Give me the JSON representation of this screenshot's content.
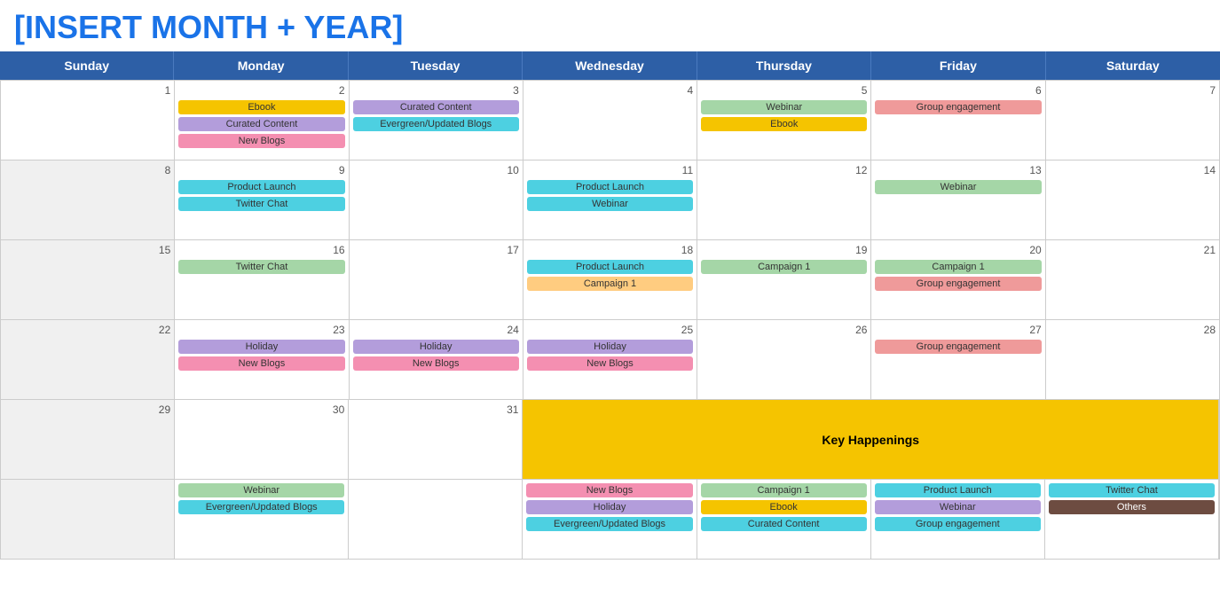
{
  "title": "[INSERT MONTH + YEAR]",
  "days": [
    "Sunday",
    "Monday",
    "Tuesday",
    "Wednesday",
    "Thursday",
    "Friday",
    "Saturday"
  ],
  "weeks": [
    {
      "cells": [
        {
          "date": "1",
          "gray": false,
          "events": []
        },
        {
          "date": "2",
          "gray": false,
          "events": [
            {
              "label": "Ebook",
              "color": "ev-yellow"
            },
            {
              "label": "Curated Content",
              "color": "ev-purple-light"
            },
            {
              "label": "New Blogs",
              "color": "ev-pink"
            }
          ]
        },
        {
          "date": "3",
          "gray": false,
          "events": [
            {
              "label": "Curated Content",
              "color": "ev-purple-light"
            },
            {
              "label": "Evergreen/Updated Blogs",
              "color": "ev-teal"
            }
          ]
        },
        {
          "date": "4",
          "gray": false,
          "events": []
        },
        {
          "date": "5",
          "gray": false,
          "events": [
            {
              "label": "Webinar",
              "color": "ev-green"
            },
            {
              "label": "Ebook",
              "color": "ev-yellow"
            }
          ]
        },
        {
          "date": "6",
          "gray": false,
          "events": [
            {
              "label": "Group engagement",
              "color": "ev-red-light"
            }
          ]
        },
        {
          "date": "7",
          "gray": false,
          "events": []
        }
      ]
    },
    {
      "cells": [
        {
          "date": "8",
          "gray": true,
          "events": []
        },
        {
          "date": "9",
          "gray": false,
          "events": [
            {
              "label": "Product Launch",
              "color": "ev-teal"
            },
            {
              "label": "Twitter Chat",
              "color": "ev-teal"
            }
          ]
        },
        {
          "date": "10",
          "gray": false,
          "events": []
        },
        {
          "date": "11",
          "gray": false,
          "events": [
            {
              "label": "Product Launch",
              "color": "ev-teal"
            },
            {
              "label": "Webinar",
              "color": "ev-teal"
            }
          ]
        },
        {
          "date": "12",
          "gray": false,
          "events": []
        },
        {
          "date": "13",
          "gray": false,
          "events": [
            {
              "label": "Webinar",
              "color": "ev-green"
            }
          ]
        },
        {
          "date": "14",
          "gray": false,
          "events": []
        }
      ]
    },
    {
      "cells": [
        {
          "date": "15",
          "gray": true,
          "events": []
        },
        {
          "date": "16",
          "gray": false,
          "events": [
            {
              "label": "Twitter Chat",
              "color": "ev-green"
            }
          ]
        },
        {
          "date": "17",
          "gray": false,
          "events": []
        },
        {
          "date": "18",
          "gray": false,
          "events": [
            {
              "label": "Product Launch",
              "color": "ev-teal"
            },
            {
              "label": "Campaign 1",
              "color": "ev-orange-light"
            }
          ]
        },
        {
          "date": "19",
          "gray": false,
          "events": [
            {
              "label": "Campaign 1",
              "color": "ev-green"
            }
          ]
        },
        {
          "date": "20",
          "gray": false,
          "events": [
            {
              "label": "Campaign 1",
              "color": "ev-green"
            },
            {
              "label": "Group engagement",
              "color": "ev-red-light"
            }
          ]
        },
        {
          "date": "21",
          "gray": false,
          "events": []
        }
      ]
    },
    {
      "cells": [
        {
          "date": "22",
          "gray": true,
          "events": []
        },
        {
          "date": "23",
          "gray": false,
          "events": [
            {
              "label": "Holiday",
              "color": "ev-purple-light"
            },
            {
              "label": "New Blogs",
              "color": "ev-pink"
            }
          ]
        },
        {
          "date": "24",
          "gray": false,
          "events": [
            {
              "label": "Holiday",
              "color": "ev-purple-light"
            },
            {
              "label": "New Blogs",
              "color": "ev-pink"
            }
          ]
        },
        {
          "date": "25",
          "gray": false,
          "events": [
            {
              "label": "Holiday",
              "color": "ev-purple-light"
            },
            {
              "label": "New Blogs",
              "color": "ev-pink"
            }
          ]
        },
        {
          "date": "26",
          "gray": false,
          "events": []
        },
        {
          "date": "27",
          "gray": false,
          "events": [
            {
              "label": "Group engagement",
              "color": "ev-red-light"
            }
          ]
        },
        {
          "date": "28",
          "gray": false,
          "events": []
        }
      ]
    },
    {
      "cells": [
        {
          "date": "29",
          "gray": true,
          "events": []
        },
        {
          "date": "30",
          "gray": false,
          "events": [
            {
              "label": "Webinar",
              "color": "ev-green"
            },
            {
              "label": "Evergreen/Updated Blogs",
              "color": "ev-teal"
            }
          ]
        },
        {
          "date": "31",
          "gray": false,
          "events": []
        },
        {
          "date": "",
          "gray": false,
          "events": [
            {
              "label": "New Blogs",
              "color": "ev-pink"
            },
            {
              "label": "Holiday",
              "color": "ev-purple-light"
            },
            {
              "label": "Evergreen/Updated Blogs",
              "color": "ev-teal"
            }
          ]
        },
        {
          "date": "",
          "gray": false,
          "events": [
            {
              "label": "Campaign 1",
              "color": "ev-green"
            },
            {
              "label": "Ebook",
              "color": "ev-yellow"
            },
            {
              "label": "Curated Content",
              "color": "ev-teal"
            }
          ]
        },
        {
          "date": "",
          "gray": false,
          "events": [
            {
              "label": "Product Launch",
              "color": "ev-teal"
            },
            {
              "label": "Webinar",
              "color": "ev-purple-light"
            },
            {
              "label": "Group engagement",
              "color": "ev-teal"
            }
          ]
        },
        {
          "date": "",
          "gray": false,
          "events": [
            {
              "label": "Twitter Chat",
              "color": "ev-teal"
            },
            {
              "label": "Others",
              "color": "ev-brown"
            }
          ]
        }
      ]
    }
  ],
  "key_happenings": {
    "label": "Key Happenings",
    "label_color": "#f5c400"
  }
}
